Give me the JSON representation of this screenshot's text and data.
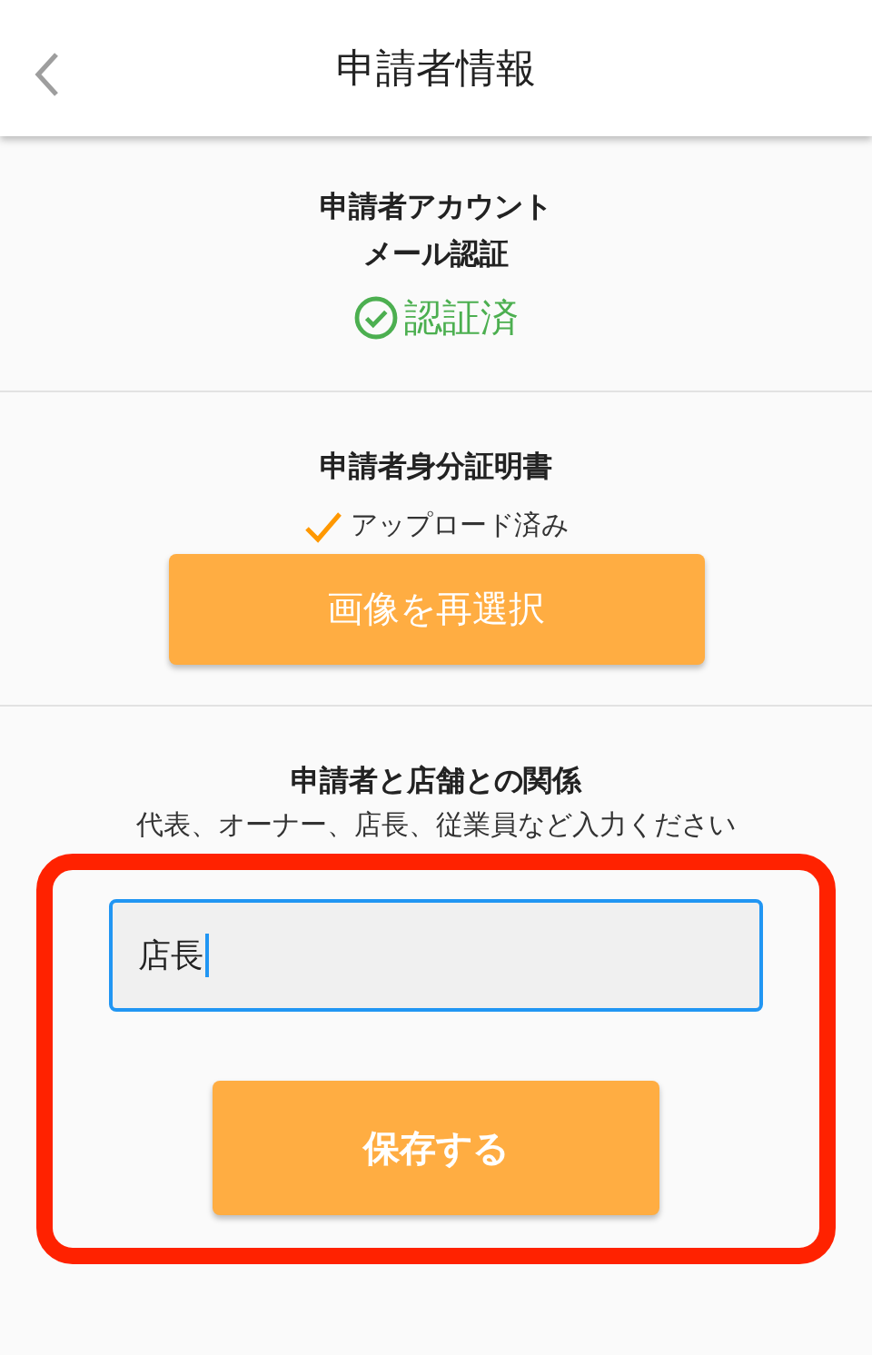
{
  "header": {
    "title": "申請者情報"
  },
  "sections": [
    {
      "kind": "account",
      "title_lines": [
        "申請者アカウント",
        "メール認証"
      ],
      "status": "認証済"
    },
    {
      "kind": "document",
      "title_lines": [
        "申請者身分証明書"
      ],
      "status": "アップロード済み",
      "button": "画像を再選択"
    },
    {
      "kind": "relation",
      "title_lines": [
        "申請者と店舗との関係"
      ],
      "hint": "代表、オーナー、店長、従業員など入力ください",
      "input": {
        "value": "店長",
        "focused": true
      },
      "button": "保存する",
      "highlighted": true
    }
  ]
}
